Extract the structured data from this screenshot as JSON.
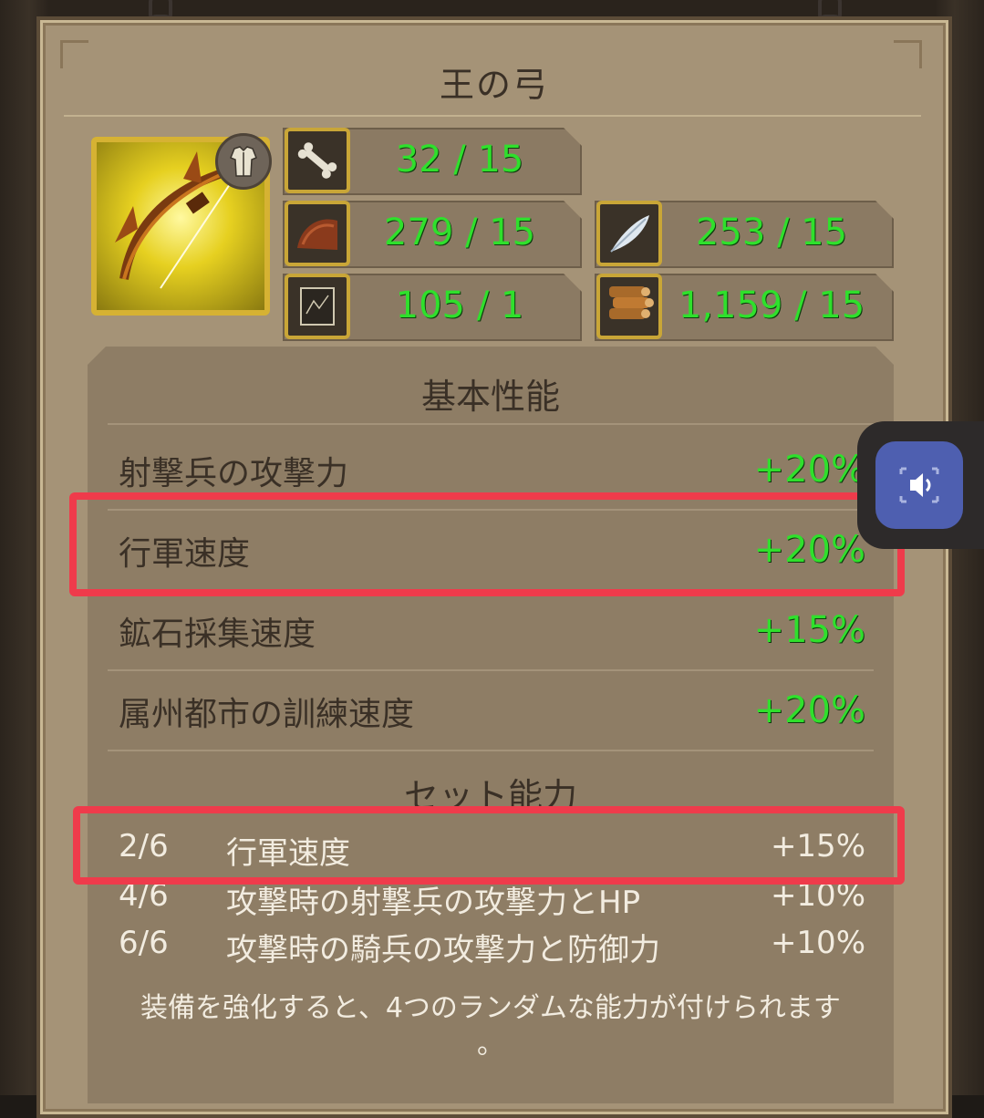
{
  "title": "王の弓",
  "resources": [
    {
      "icon": "bone-icon",
      "amount": "32 / 15"
    },
    {
      "icon": "hide-icon",
      "amount": "279 / 15"
    },
    {
      "icon": "feather-icon",
      "amount": "253 / 15"
    },
    {
      "icon": "scroll-icon",
      "amount": "105 / 1"
    },
    {
      "icon": "wood-icon",
      "amount": "1,159 / 15"
    }
  ],
  "basic_section_title": "基本性能",
  "basic_stats": [
    {
      "label": "射撃兵の攻撃力",
      "value": "+20%"
    },
    {
      "label": "行軍速度",
      "value": "+20%"
    },
    {
      "label": "鉱石採集速度",
      "value": "+15%"
    },
    {
      "label": "属州都市の訓練速度",
      "value": "+20%"
    }
  ],
  "set_section_title": "セット能力",
  "set_stats": [
    {
      "level": "2/6",
      "label": "行軍速度",
      "value": "+15%"
    },
    {
      "level": "4/6",
      "label": "攻撃時の射撃兵の攻撃力とHP",
      "value": "+10%"
    },
    {
      "level": "6/6",
      "label": "攻撃時の騎兵の攻撃力と防御力",
      "value": "+10%"
    }
  ],
  "note_line1": "装備を強化すると、4つのランダムな能力が付けられます",
  "note_line2": "。",
  "colors": {
    "panel": "#a59377",
    "value_green": "#2fe02c",
    "highlight_red": "#ef3b4b",
    "float_button": "#4e5fb0"
  }
}
